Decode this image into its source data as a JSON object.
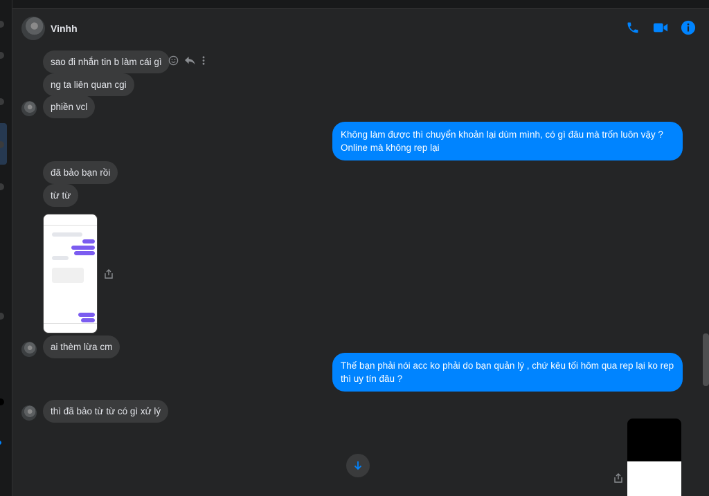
{
  "window": {
    "title": ""
  },
  "contact": {
    "name": "Vinhh"
  },
  "header": {
    "actions": [
      {
        "name": "phone-icon"
      },
      {
        "name": "video-icon"
      },
      {
        "name": "info-icon"
      }
    ]
  },
  "colors": {
    "accent": "#0084ff",
    "bubble_in": "#3a3b3c",
    "background": "#242526"
  },
  "messages": [
    {
      "from": "them",
      "text": "sao đi nhắn tin b làm cái gì"
    },
    {
      "from": "them",
      "text": "ng ta liên quan cgi"
    },
    {
      "from": "them",
      "text": "phiền vcl"
    },
    {
      "from": "me",
      "text": "Không làm được thì chuyển khoản lại dùm mình, có gì đâu mà trốn luôn vậy ? Online mà không rep lại"
    },
    {
      "from": "them",
      "text": "đã bảo bạn rồi"
    },
    {
      "from": "them",
      "text": "từ từ"
    },
    {
      "from": "them",
      "type": "image"
    },
    {
      "from": "them",
      "text": "ai thèm lừa cm"
    },
    {
      "from": "me",
      "text": "Thế bạn phải nói acc ko phải do bạn quản lý  , chứ kêu tối hôm qua rep lại ko rep thì uy tín đâu ?"
    },
    {
      "from": "them",
      "text": "thì đã bảo từ từ có gì xử lý"
    },
    {
      "from": "me",
      "type": "image"
    }
  ]
}
